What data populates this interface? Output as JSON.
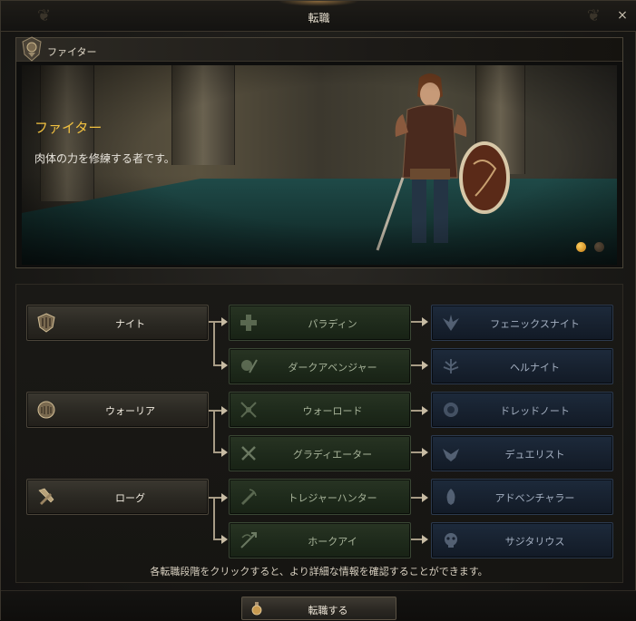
{
  "window": {
    "title": "転職",
    "close_label": "×"
  },
  "banner": {
    "header_label": "ファイター",
    "class_name": "ファイター",
    "description": "肉体の力を修練する者です。",
    "slides": {
      "count": 2,
      "active_index": 0
    }
  },
  "tree": {
    "tier1": [
      {
        "label": "ナイト",
        "icon": "shield-emblem-icon"
      },
      {
        "label": "ウォーリア",
        "icon": "helmet-emblem-icon"
      },
      {
        "label": "ローグ",
        "icon": "crossed-tools-icon"
      }
    ],
    "tier2": [
      {
        "label": "パラディン",
        "icon": "cross-icon"
      },
      {
        "label": "ダークアベンジャー",
        "icon": "skull-sword-icon"
      },
      {
        "label": "ウォーロード",
        "icon": "crossed-axes-icon"
      },
      {
        "label": "グラディエーター",
        "icon": "crossed-swords-icon"
      },
      {
        "label": "トレジャーハンター",
        "icon": "claw-dagger-icon"
      },
      {
        "label": "ホークアイ",
        "icon": "bow-arrow-icon"
      }
    ],
    "tier3": [
      {
        "label": "フェニックスナイト",
        "icon": "phoenix-icon"
      },
      {
        "label": "ヘルナイト",
        "icon": "demon-wing-icon"
      },
      {
        "label": "ドレッドノート",
        "icon": "lion-crest-icon"
      },
      {
        "label": "デュエリスト",
        "icon": "winged-blades-icon"
      },
      {
        "label": "アドベンチャラー",
        "icon": "feather-crest-icon"
      },
      {
        "label": "サジタリウス",
        "icon": "skull-crest-icon"
      }
    ]
  },
  "hint": "各転職段階をクリックすると、より詳細な情報を確認することができます。",
  "footer": {
    "change_button_label": "転職する",
    "change_button_icon": "potion-icon"
  },
  "colors": {
    "accent_gold": "#f0c040",
    "tier2_green": "#1e2a1b",
    "tier3_blue": "#17212f"
  }
}
